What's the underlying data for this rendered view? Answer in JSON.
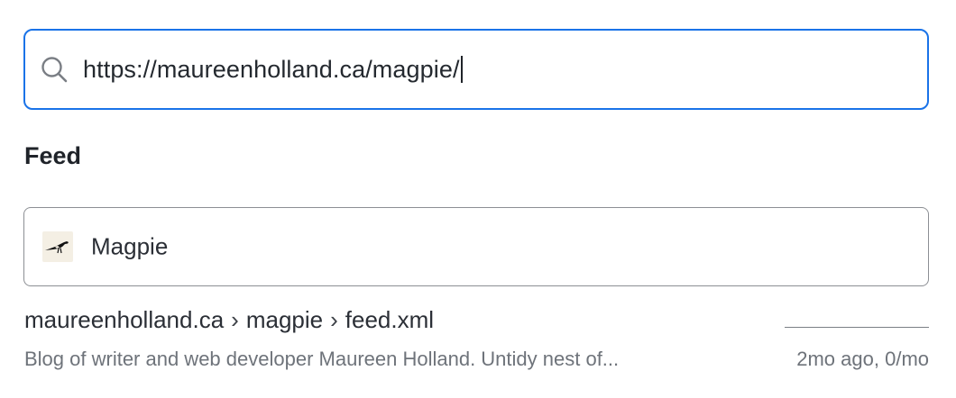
{
  "search": {
    "value": "https://maureenholland.ca/magpie/",
    "icon": "search-icon",
    "focus_color": "#1a73e8"
  },
  "section": {
    "heading": "Feed"
  },
  "feed": {
    "name": "Magpie",
    "thumbnail_icon": "magpie-bird-icon",
    "path": {
      "domain": "maureenholland.ca",
      "separator": "›",
      "segment": "magpie",
      "file": "feed.xml"
    },
    "description": "Blog of writer and web developer Maureen Holland. Untidy nest of...",
    "meta": "2mo ago, 0/mo"
  }
}
